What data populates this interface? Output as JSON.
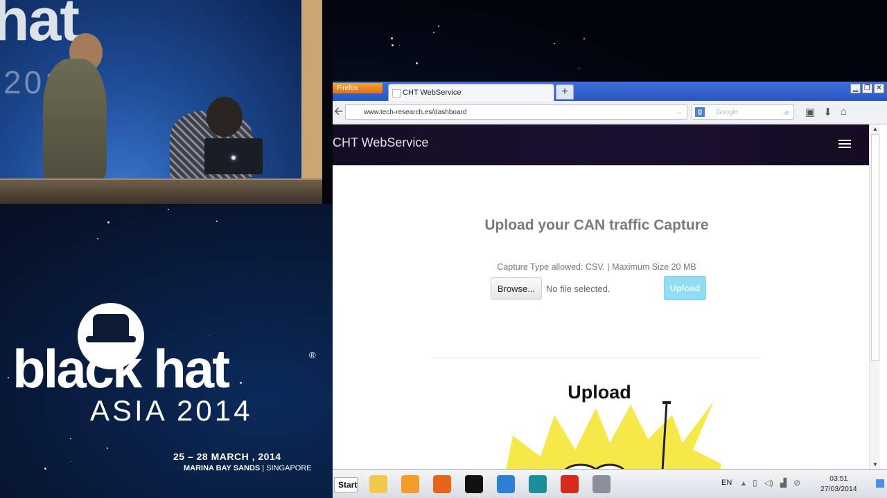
{
  "logo": {
    "wordmark": "black hat",
    "reg": "®",
    "edition": "ASIA 2014",
    "dates": "25 – 28 MARCH , 2014",
    "venue_name": "MARINA BAY SANDS",
    "venue_sep": "|",
    "venue_city": "SINGAPORE"
  },
  "video_backdrop": {
    "text": "hat",
    "year": "2014"
  },
  "browser": {
    "menu_label": "Firefox",
    "tab_title": "CHT WebService",
    "new_tab_label": "+",
    "window_buttons": {
      "minimize": "▁",
      "restore": "❐",
      "close": "✕"
    },
    "back_glyph": "🡨",
    "url": "www.tech-research.es/dashboard",
    "go_glyph": "→",
    "search_engine_glyph": "g",
    "search_placeholder": "Google",
    "search_glyph": "⌕",
    "bookmarks_glyph": "▣",
    "download_glyph": "⬇",
    "home_glyph": "⌂"
  },
  "page": {
    "brand": "CHT WebService",
    "heading": "Upload your CAN traffic Capture",
    "hint": "Capture Type allowed: CSV. | Maximum Size 20 MB",
    "browse_label": "Browse...",
    "no_file": "No file selected.",
    "upload_label": "Upload",
    "section_title": "Upload"
  },
  "taskbar": {
    "start_label": "Start",
    "apps": [
      {
        "name": "explorer",
        "color": "#f2c94c"
      },
      {
        "name": "media-player",
        "color": "#f59b2a"
      },
      {
        "name": "firefox",
        "color": "#e8641b"
      },
      {
        "name": "terminal",
        "color": "#111111"
      },
      {
        "name": "virtual-machine",
        "color": "#2f7fd6"
      },
      {
        "name": "arduino",
        "color": "#1b8e9c"
      },
      {
        "name": "can-tool",
        "color": "#d9281c"
      },
      {
        "name": "search-tool",
        "color": "#8a8f99"
      }
    ],
    "language": "EN",
    "time": "03:51",
    "date": "27/03/2014"
  },
  "colors": {
    "accent": "#8fdcf4",
    "header_bg": "#1c1030",
    "titlebar": "#2a57c4"
  }
}
